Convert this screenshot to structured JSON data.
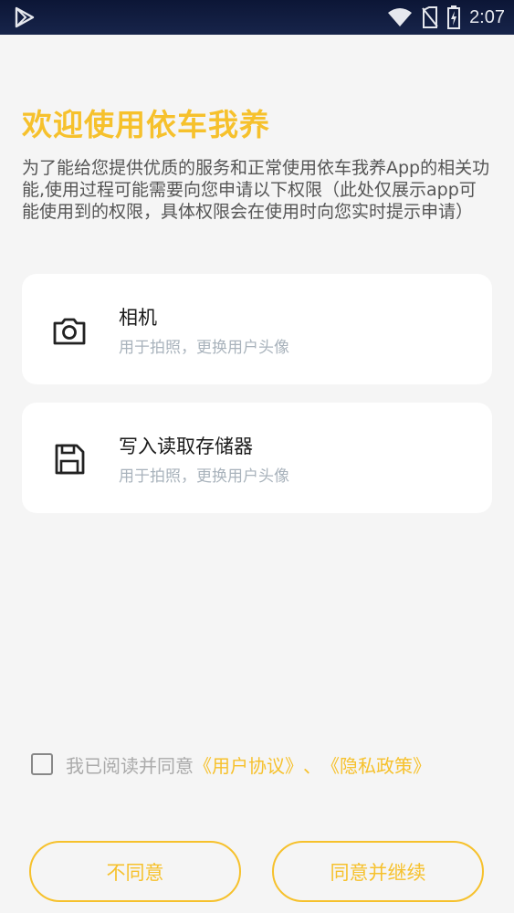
{
  "status_bar": {
    "time": "2:07"
  },
  "title": "欢迎使用依车我养",
  "intro": "为了能给您提供优质的服务和正常使用依车我养App的相关功能,使用过程可能需要向您申请以下权限（此处仅展示app可能使用到的权限，具体权限会在使用时向您实时提示申请）",
  "permissions": [
    {
      "name": "相机",
      "desc": "用于拍照，更换用户头像",
      "icon": "camera-icon"
    },
    {
      "name": "写入读取存储器",
      "desc": "用于拍照，更换用户头像",
      "icon": "save-icon"
    }
  ],
  "agreement": {
    "checked": false,
    "prefix": "我已阅读并同意",
    "user_agreement": "《用户协议》",
    "separator": "、",
    "privacy_policy": "《隐私政策》"
  },
  "buttons": {
    "disagree": "不同意",
    "agree": "同意并继续"
  },
  "colors": {
    "accent": "#f6c12c",
    "background": "#f5f5f5",
    "card": "#ffffff",
    "status_bar": "#0f1a3a"
  }
}
